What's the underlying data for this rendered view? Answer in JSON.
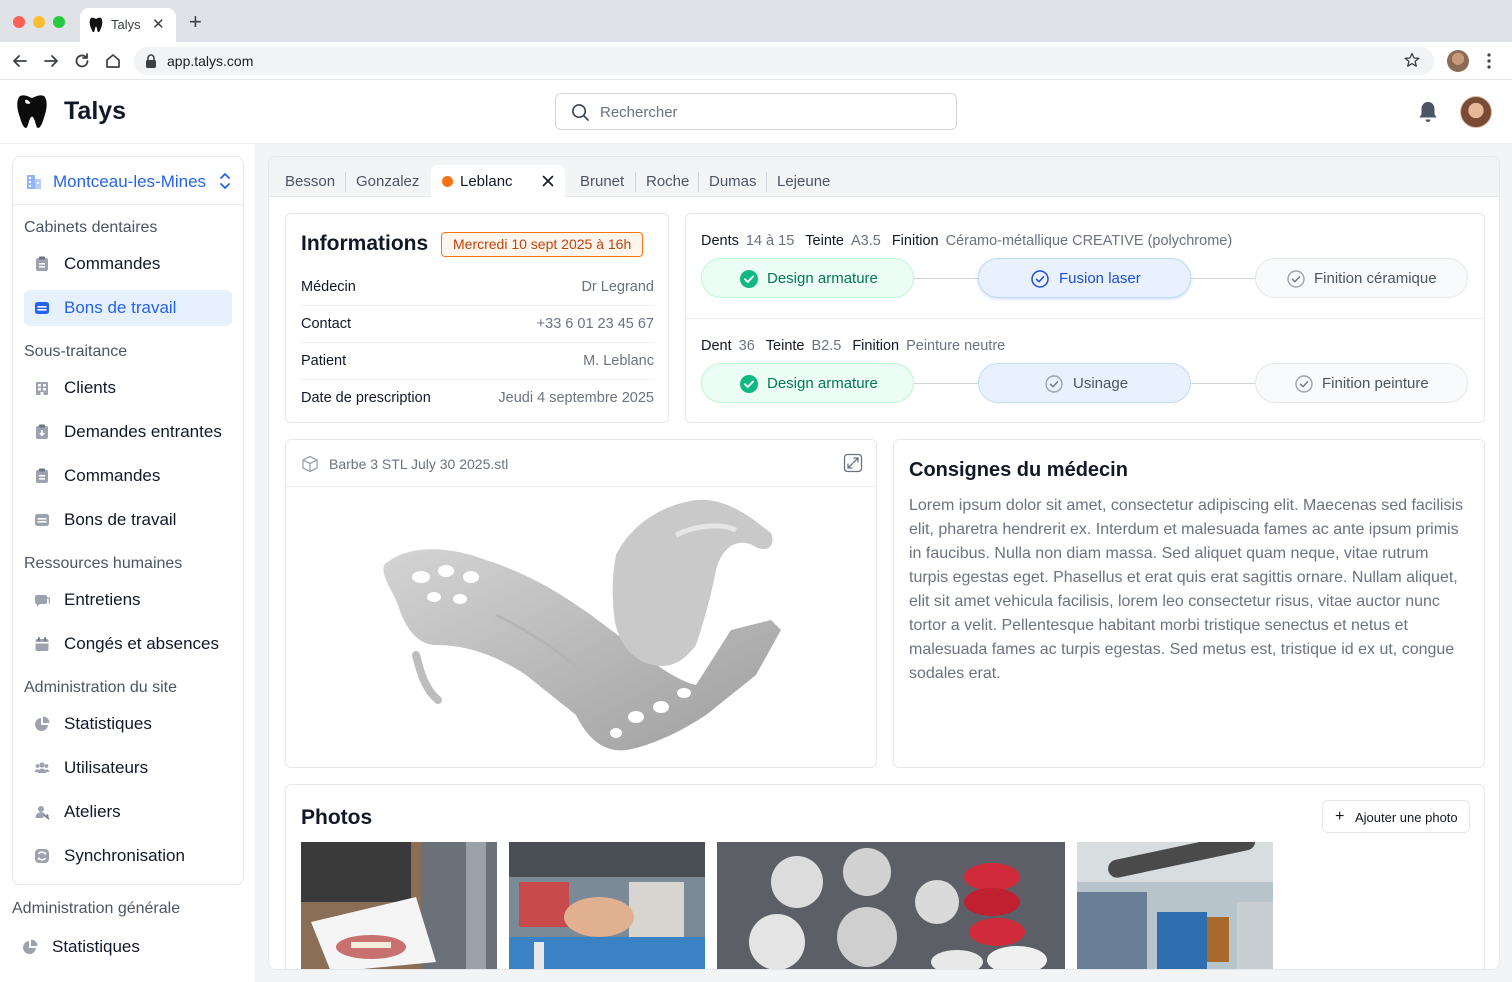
{
  "browser": {
    "tab_title": "Talys",
    "tab_close": "✕",
    "new_tab": "+",
    "url": "app.talys.com"
  },
  "header": {
    "brand": "Talys",
    "search_placeholder": "Rechercher"
  },
  "sidebar": {
    "site_name": "Montceau-les-Mines",
    "sections": [
      {
        "title": "Cabinets dentaires",
        "items": [
          {
            "label": "Commandes",
            "icon": "clipboard-icon"
          },
          {
            "label": "Bons de travail",
            "icon": "tray-icon",
            "active": true
          }
        ]
      },
      {
        "title": "Sous-traitance",
        "items": [
          {
            "label": "Clients",
            "icon": "building-icon"
          },
          {
            "label": "Demandes entrantes",
            "icon": "clipboard-icon"
          },
          {
            "label": "Commandes",
            "icon": "clipboard-icon"
          },
          {
            "label": "Bons de travail",
            "icon": "tray-icon"
          }
        ]
      },
      {
        "title": "Ressources humaines",
        "items": [
          {
            "label": "Entretiens",
            "icon": "chat-icon"
          },
          {
            "label": "Congés et absences",
            "icon": "calendar-icon"
          }
        ]
      },
      {
        "title": "Administration du site",
        "items": [
          {
            "label": "Statistiques",
            "icon": "pie-chart-icon"
          },
          {
            "label": "Utilisateurs",
            "icon": "users-icon"
          },
          {
            "label": "Ateliers",
            "icon": "workshop-icon"
          },
          {
            "label": "Synchronisation",
            "icon": "sync-icon"
          }
        ]
      }
    ],
    "global_section": {
      "title": "Administration générale",
      "items": [
        {
          "label": "Statistiques",
          "icon": "pie-chart-icon"
        }
      ]
    }
  },
  "patient_tabs": {
    "before": [
      "Besson",
      "Gonzalez"
    ],
    "active": "Leblanc",
    "after": [
      "Brunet",
      "Roche",
      "Dumas",
      "Lejeune"
    ]
  },
  "info": {
    "title": "Informations",
    "date_badge": "Mercredi 10 sept 2025 à 16h",
    "rows": [
      {
        "label": "Médecin",
        "value": "Dr Legrand"
      },
      {
        "label": "Contact",
        "value": "+33 6 01 23 45 67"
      },
      {
        "label": "Patient",
        "value": "M. Leblanc"
      },
      {
        "label": "Date de prescription",
        "value": "Jeudi 4 septembre 2025"
      }
    ]
  },
  "work": [
    {
      "teeth_label": "Dents",
      "teeth": "14 à 15",
      "shade_label": "Teinte",
      "shade": "A3.5",
      "finish_label": "Finition",
      "finish": "Céramo-métallique CREATIVE (polychrome)",
      "steps": [
        {
          "label": "Design armature",
          "status": "done"
        },
        {
          "label": "Fusion laser",
          "status": "current"
        },
        {
          "label": "Finition céramique",
          "status": "pending"
        }
      ]
    },
    {
      "teeth_label": "Dent",
      "teeth": "36",
      "shade_label": "Teinte",
      "shade": "B2.5",
      "finish_label": "Finition",
      "finish": "Peinture neutre",
      "steps": [
        {
          "label": "Design armature",
          "status": "done"
        },
        {
          "label": "Usinage",
          "status": "current"
        },
        {
          "label": "Finition peinture",
          "status": "pending"
        }
      ]
    }
  ],
  "viewer": {
    "filename": "Barbe 3 STL July 30 2025.stl"
  },
  "consignes": {
    "title": "Consignes du médecin",
    "text": "Lorem ipsum dolor sit amet, consectetur adipiscing elit. Maecenas sed facilisis elit, pharetra hendrerit ex. Interdum et malesuada fames ac ante ipsum primis in faucibus. Nulla non diam massa. Sed aliquet quam neque, vitae rutrum turpis egestas eget. Phasellus et erat quis erat sagittis ornare. Nullam aliquet, elit sit amet vehicula facilisis, lorem leo consectetur risus, vitae auctor nunc tortor a velit. Pellentesque habitant morbi tristique senectus et netus et malesuada fames ac turpis egestas. Sed metus est, tristique id ex ut, congue sodales erat."
  },
  "photos": {
    "title": "Photos",
    "add_button": "Ajouter une photo",
    "add_icon": "plus-icon"
  },
  "colors": {
    "accent": "#2563eb",
    "badge_orange": "#f97316",
    "done_green": "#10b981"
  }
}
